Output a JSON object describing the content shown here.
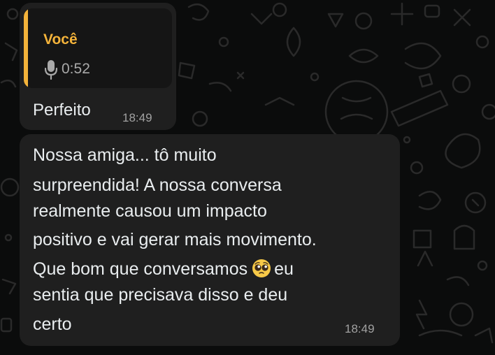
{
  "chat": {
    "messages": [
      {
        "quote": {
          "author": "Você",
          "duration": "0:52",
          "icon": "microphone-icon"
        },
        "text": "Perfeito",
        "time": "18:49"
      },
      {
        "lines": [
          "Nossa amiga... tô muito",
          "surpreendida! A nossa conversa",
          "realmente causou um impacto",
          "positivo e vai gerar mais movimento.",
          "Que bom que conversamos",
          "eu",
          "sentia que precisava disso e deu",
          "certo"
        ],
        "emoji": "pleading-face-emoji",
        "time": "18:49"
      }
    ]
  },
  "colors": {
    "background": "#0b0c0c",
    "bubble": "#1f1f1f",
    "quote_accent": "#f4b33a",
    "text": "#e9edef",
    "timestamp": "#a1a1a1"
  }
}
